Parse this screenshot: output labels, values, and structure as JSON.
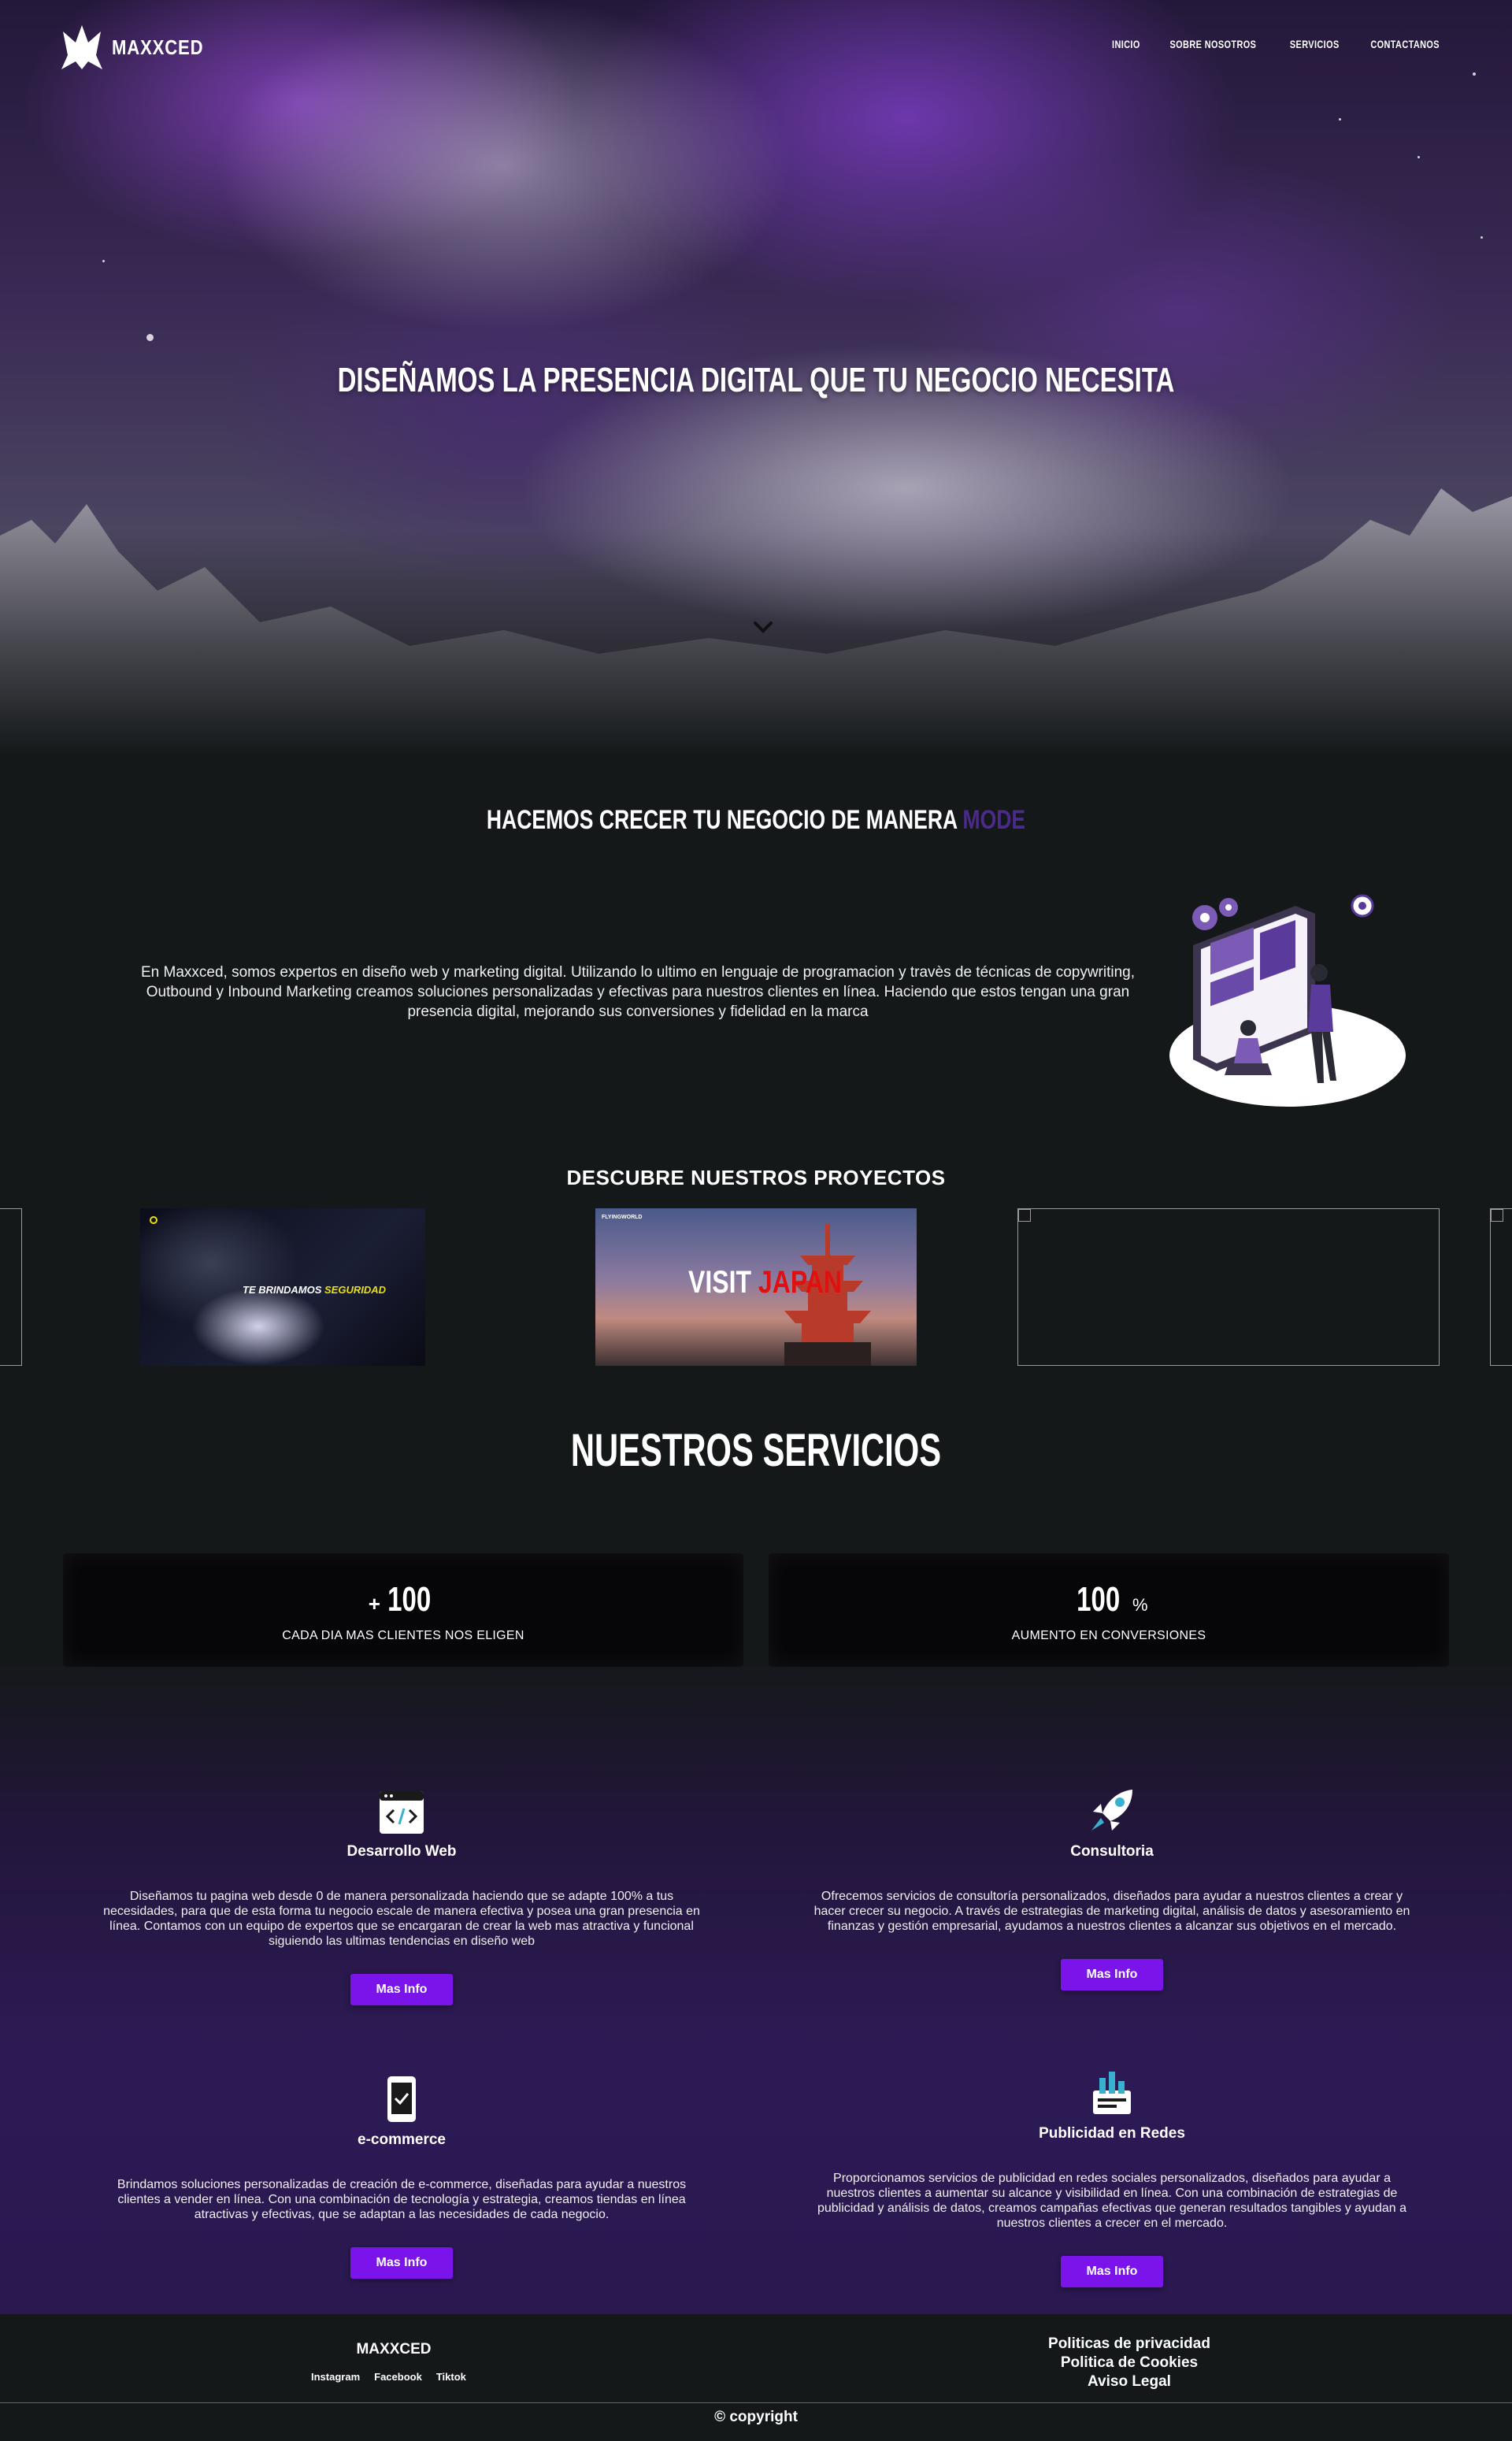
{
  "brand": {
    "name": "MAXXCED"
  },
  "nav": {
    "items": [
      "INICIO",
      "SOBRE NOSOTROS",
      "SERVICIOS",
      "CONTACTANOS"
    ]
  },
  "hero": {
    "title": "DISEÑAMOS LA PRESENCIA DIGITAL QUE TU NEGOCIO NECESITA"
  },
  "grow": {
    "title_main": "HACEMOS CRECER TU NEGOCIO DE MANERA ",
    "title_accent": "MODE",
    "text": "En Maxxced, somos expertos en diseño web y marketing digital. Utilizando lo ultimo en lenguaje de programacion y travès de técnicas de copywriting, Outbound y Inbound Marketing creamos soluciones personalizadas y efectivas para nuestros clientes en línea. Haciendo que estos tengan una gran presencia digital, mejorando sus conversiones y fidelidad en la marca"
  },
  "projects": {
    "title": "DESCUBRE NUESTROS PROYECTOS",
    "p1_text_a": "TE BRINDAMOS ",
    "p1_text_b": "SEGURIDAD",
    "p2_text_a": "VISIT ",
    "p2_text_b": "JAPAN",
    "p2_brand": "FLYINGWORLD"
  },
  "services": {
    "title": "NUESTROS SERVICIOS",
    "stats": [
      {
        "prefix": "+",
        "number": "100",
        "suffix": "",
        "label": "CADA DIA MAS CLIENTES NOS ELIGEN"
      },
      {
        "prefix": "",
        "number": "100",
        "suffix": " %",
        "label": "AUMENTO EN CONVERSIONES"
      }
    ],
    "cards": [
      {
        "title": "Desarrollo Web",
        "text": "Diseñamos tu pagina web desde 0 de manera personalizada haciendo que se adapte 100% a tus necesidades, para que de esta forma tu negocio escale de manera efectiva y posea una gran presencia en línea. Contamos con un equipo de expertos que se encargaran de crear la web mas atractiva y funcional siguiendo las ultimas tendencias en diseño web",
        "button": "Mas Info"
      },
      {
        "title": "Consultoria",
        "text": "Ofrecemos servicios de consultoría personalizados, diseñados para ayudar a nuestros clientes a crear y hacer crecer su negocio. A través de estrategias de marketing digital, análisis de datos y asesoramiento en finanzas y gestión empresarial, ayudamos a nuestros clientes a alcanzar sus objetivos en el mercado.",
        "button": "Mas Info"
      },
      {
        "title": "e-commerce",
        "text": "Brindamos soluciones personalizadas de creación de e-commerce, diseñadas para ayudar a nuestros clientes a vender en línea. Con una combinación de tecnología y estrategia, creamos tiendas en línea atractivas y efectivas, que se adaptan a las necesidades de cada negocio.",
        "button": "Mas Info"
      },
      {
        "title": "Publicidad en Redes",
        "text": "Proporcionamos servicios de publicidad en redes sociales personalizados, diseñados para ayudar a nuestros clientes a aumentar su alcance y visibilidad en línea. Con una combinación de estrategias de publicidad y análisis de datos, creamos campañas efectivas que generan resultados tangibles y ayudan a nuestros clientes a crecer en el mercado.",
        "button": "Mas Info"
      }
    ]
  },
  "footer": {
    "brand": "MAXXCED",
    "social": [
      "Instagram",
      "Facebook",
      "Tiktok"
    ],
    "links": [
      "Politicas de privacidad",
      "Politica de Cookies",
      "Aviso Legal"
    ],
    "copyright": "© copyright"
  },
  "colors": {
    "accent": "#7a14ea",
    "accent_text": "#4b2a8a",
    "background": "#141819"
  },
  "icons": [
    "logo-mark",
    "chevron-down-icon",
    "code-window-icon",
    "rocket-icon",
    "smartphone-check-icon",
    "megaphone-chart-icon"
  ]
}
